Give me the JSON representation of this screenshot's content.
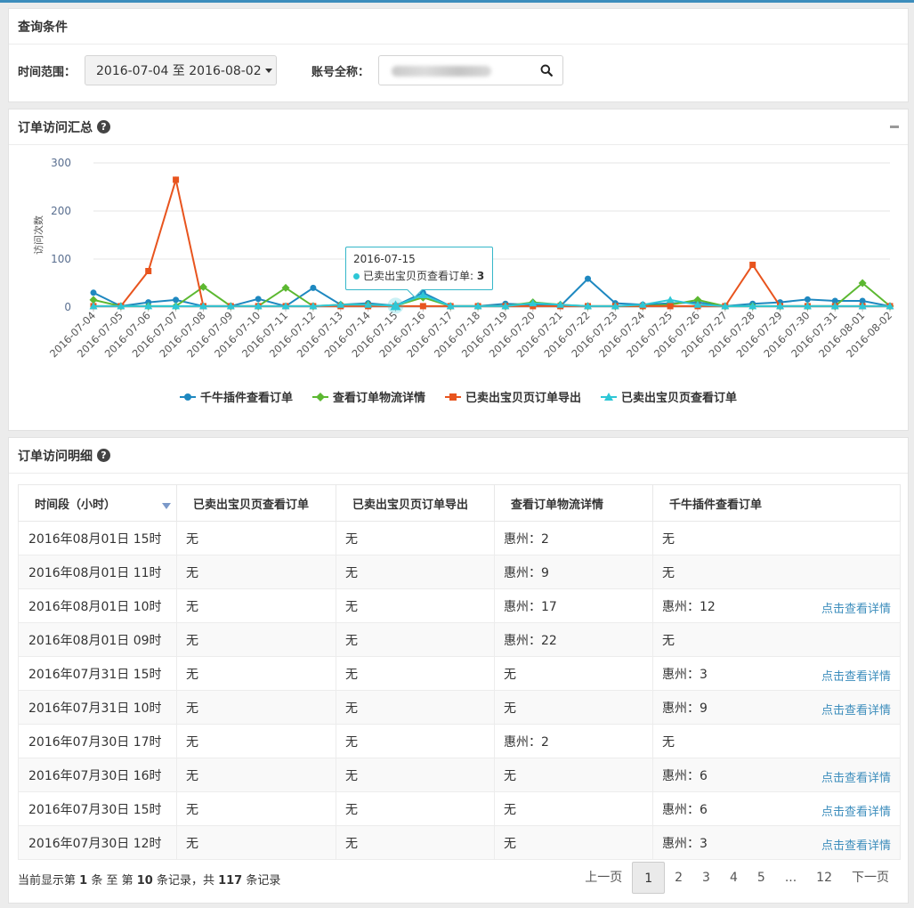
{
  "query": {
    "title": "查询条件",
    "time_label": "时间范围：",
    "date_range": "2016-07-04 至 2016-08-02",
    "account_label": "账号全称："
  },
  "summary": {
    "title": "订单访问汇总",
    "help_icon": "question-circle-icon",
    "tooltip": {
      "date": "2016-07-15",
      "series": "已卖出宝贝页查看订单",
      "value": "3"
    }
  },
  "chart_data": {
    "type": "line",
    "ylabel": "访问次数",
    "ylim": [
      0,
      300
    ],
    "yticks": [
      "0",
      "100",
      "200",
      "300"
    ],
    "x": [
      "2016-07-04",
      "2016-07-05",
      "2016-07-06",
      "2016-07-07",
      "2016-07-08",
      "2016-07-09",
      "2016-07-10",
      "2016-07-11",
      "2016-07-12",
      "2016-07-13",
      "2016-07-14",
      "2016-07-15",
      "2016-07-16",
      "2016-07-17",
      "2016-07-18",
      "2016-07-19",
      "2016-07-20",
      "2016-07-21",
      "2016-07-22",
      "2016-07-23",
      "2016-07-24",
      "2016-07-25",
      "2016-07-26",
      "2016-07-27",
      "2016-07-28",
      "2016-07-29",
      "2016-07-30",
      "2016-07-31",
      "2016-08-01",
      "2016-08-02"
    ],
    "legend_position": "bottom",
    "series": [
      {
        "name": "千牛插件查看订单",
        "color": "#1e88c0",
        "marker": "circle",
        "values": [
          30,
          2,
          10,
          15,
          2,
          2,
          17,
          2,
          40,
          5,
          8,
          3,
          30,
          2,
          2,
          7,
          5,
          2,
          59,
          8,
          5,
          8,
          10,
          2,
          7,
          10,
          16,
          13,
          13,
          2
        ]
      },
      {
        "name": "查看订单物流详情",
        "color": "#5cb831",
        "marker": "diamond",
        "values": [
          15,
          2,
          2,
          2,
          42,
          2,
          2,
          40,
          2,
          5,
          5,
          3,
          20,
          2,
          2,
          2,
          10,
          5,
          2,
          2,
          2,
          5,
          15,
          2,
          2,
          2,
          2,
          2,
          50,
          2
        ]
      },
      {
        "name": "已卖出宝贝页订单导出",
        "color": "#e8541e",
        "marker": "square",
        "values": [
          2,
          2,
          75,
          265,
          2,
          2,
          2,
          2,
          2,
          2,
          2,
          2,
          2,
          2,
          2,
          2,
          2,
          2,
          2,
          2,
          2,
          2,
          2,
          2,
          88,
          2,
          2,
          2,
          2,
          2
        ]
      },
      {
        "name": "已卖出宝贝页查看订单",
        "color": "#2ec7d6",
        "marker": "triangle",
        "values": [
          2,
          2,
          2,
          2,
          2,
          2,
          2,
          2,
          2,
          5,
          5,
          3,
          25,
          2,
          2,
          2,
          8,
          5,
          2,
          2,
          5,
          15,
          5,
          2,
          2,
          2,
          2,
          2,
          2,
          2
        ]
      }
    ]
  },
  "detail": {
    "title": "订单访问明细",
    "help_icon": "question-circle-icon",
    "columns": [
      "时间段（小时）",
      "已卖出宝贝页查看订单",
      "已卖出宝贝页订单导出",
      "查看订单物流详情",
      "千牛插件查看订单"
    ],
    "rows": [
      {
        "cells": [
          "2016年08月01日 15时",
          "无",
          "无",
          "惠州：2",
          "无"
        ],
        "link": ""
      },
      {
        "cells": [
          "2016年08月01日 11时",
          "无",
          "无",
          "惠州：9",
          "无"
        ],
        "link": ""
      },
      {
        "cells": [
          "2016年08月01日 10时",
          "无",
          "无",
          "惠州：17",
          "惠州：12"
        ],
        "link": "点击查看详情"
      },
      {
        "cells": [
          "2016年08月01日 09时",
          "无",
          "无",
          "惠州：22",
          "无"
        ],
        "link": ""
      },
      {
        "cells": [
          "2016年07月31日 15时",
          "无",
          "无",
          "无",
          "惠州：3"
        ],
        "link": "点击查看详情"
      },
      {
        "cells": [
          "2016年07月31日 10时",
          "无",
          "无",
          "无",
          "惠州：9"
        ],
        "link": "点击查看详情"
      },
      {
        "cells": [
          "2016年07月30日 17时",
          "无",
          "无",
          "惠州：2",
          "无"
        ],
        "link": ""
      },
      {
        "cells": [
          "2016年07月30日 16时",
          "无",
          "无",
          "无",
          "惠州：6"
        ],
        "link": "点击查看详情"
      },
      {
        "cells": [
          "2016年07月30日 15时",
          "无",
          "无",
          "无",
          "惠州：6"
        ],
        "link": "点击查看详情"
      },
      {
        "cells": [
          "2016年07月30日 12时",
          "无",
          "无",
          "无",
          "惠州：3"
        ],
        "link": "点击查看详情"
      }
    ],
    "info": {
      "p1": "当前显示第 ",
      "start": "1",
      "p2": " 条 至 第 ",
      "end": "10",
      "p3": "条记录，共 ",
      "total": "117",
      "p4": " 条记录"
    },
    "pager": {
      "prev": "上一页",
      "pages": [
        "1",
        "2",
        "3",
        "4",
        "5",
        "...",
        "12"
      ],
      "active": "1",
      "next": "下一页"
    }
  }
}
